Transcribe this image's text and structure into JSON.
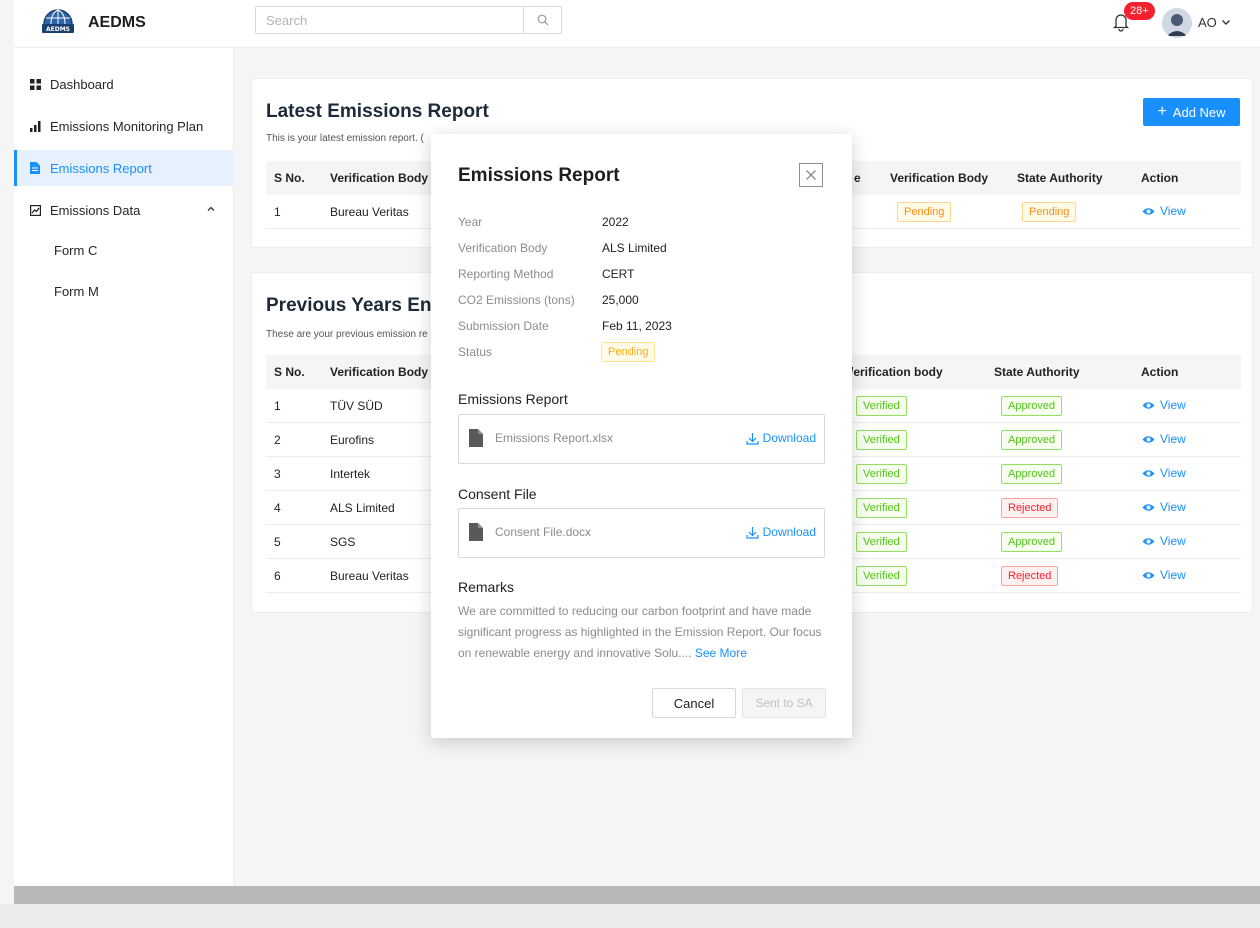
{
  "header": {
    "app_name": "AEDMS",
    "search_placeholder": "Search",
    "notification_count": "28+",
    "user_initials": "AO"
  },
  "sidebar": {
    "items": [
      {
        "label": "Dashboard",
        "icon": "grid-icon"
      },
      {
        "label": "Emissions Monitoring Plan",
        "icon": "bar-chart-icon"
      },
      {
        "label": "Emissions Report",
        "icon": "file-icon",
        "active": true
      },
      {
        "label": "Emissions Data",
        "icon": "chart-box-icon",
        "expanded": true
      }
    ],
    "sub_items": [
      {
        "label": "Form C"
      },
      {
        "label": "Form M"
      }
    ]
  },
  "latest": {
    "title": "Latest Emissions Report",
    "subtitle": "This is your latest emission report. (",
    "add_new_label": "Add New",
    "columns": [
      "S No.",
      "Verification Body",
      "e",
      "Verification Body",
      "State Authority",
      "Action"
    ],
    "rows": [
      {
        "sno": "1",
        "verification_body": "Bureau Veritas",
        "vb_status": "Pending",
        "sa_status": "Pending",
        "action": "View"
      }
    ]
  },
  "previous": {
    "title": "Previous Years En",
    "subtitle": "These are your previous emission re",
    "columns": [
      "S No.",
      "Verification Body",
      "/erification body",
      "State Authority",
      "Action"
    ],
    "rows": [
      {
        "sno": "1",
        "verification_body": "TÜV SÜD",
        "vb_status": "Verified",
        "sa_status": "Approved",
        "action": "View"
      },
      {
        "sno": "2",
        "verification_body": "Eurofins",
        "vb_status": "Verified",
        "sa_status": "Approved",
        "action": "View"
      },
      {
        "sno": "3",
        "verification_body": "Intertek",
        "vb_status": "Verified",
        "sa_status": "Approved",
        "action": "View"
      },
      {
        "sno": "4",
        "verification_body": "ALS Limited",
        "vb_status": "Verified",
        "sa_status": "Rejected",
        "action": "View"
      },
      {
        "sno": "5",
        "verification_body": "SGS",
        "vb_status": "Verified",
        "sa_status": "Approved",
        "action": "View"
      },
      {
        "sno": "6",
        "verification_body": "Bureau Veritas",
        "vb_status": "Verified",
        "sa_status": "Rejected",
        "action": "View"
      }
    ]
  },
  "modal": {
    "title": "Emissions Report",
    "fields": [
      {
        "label": "Year",
        "value": "2022"
      },
      {
        "label": "Verification Body",
        "value": "ALS Limited"
      },
      {
        "label": "Reporting Method",
        "value": "CERT"
      },
      {
        "label": "CO2 Emissions (tons)",
        "value": "25,000"
      },
      {
        "label": "Submission Date",
        "value": "Feb 11, 2023"
      },
      {
        "label": "Status",
        "value": "Pending"
      }
    ],
    "report_section": "Emissions Report",
    "report_file": "Emissions Report.xlsx",
    "consent_section": "Consent File",
    "consent_file": "Consent File.docx",
    "download_label": "Download",
    "remarks_label": "Remarks",
    "remarks_text": "We are committed to reducing our carbon footprint and have made significant progress as highlighted in the Emission Report. Our focus on renewable energy and innovative Solu....",
    "see_more": "See More",
    "cancel_label": "Cancel",
    "sent_label": "Sent to SA"
  },
  "colors": {
    "accent": "#1890ff",
    "active_bg": "#e6f1fd",
    "pending": "#fa8c16",
    "verified": "#52c41a",
    "rejected": "#f5222d"
  }
}
